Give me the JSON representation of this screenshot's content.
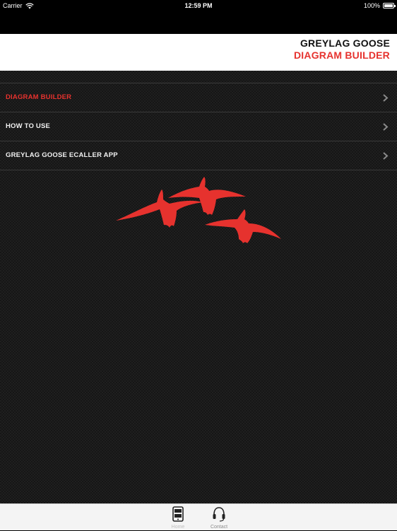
{
  "status_bar": {
    "carrier": "Carrier",
    "time": "12:59 PM",
    "battery": "100%"
  },
  "header": {
    "title_line1": "GREYLAG GOOSE",
    "title_line2": "DIAGRAM BUILDER"
  },
  "menu": {
    "items": [
      {
        "label": "DIAGRAM BUILDER",
        "active": true
      },
      {
        "label": "HOW TO USE",
        "active": false
      },
      {
        "label": "GREYLAG GOOSE ECALLER APP",
        "active": false
      }
    ]
  },
  "tabbar": {
    "tabs": [
      {
        "label": "Home",
        "icon": "home-phone-icon"
      },
      {
        "label": "Contact",
        "icon": "headset-icon"
      }
    ]
  },
  "colors": {
    "accent": "#e6322e",
    "background": "#161616"
  }
}
